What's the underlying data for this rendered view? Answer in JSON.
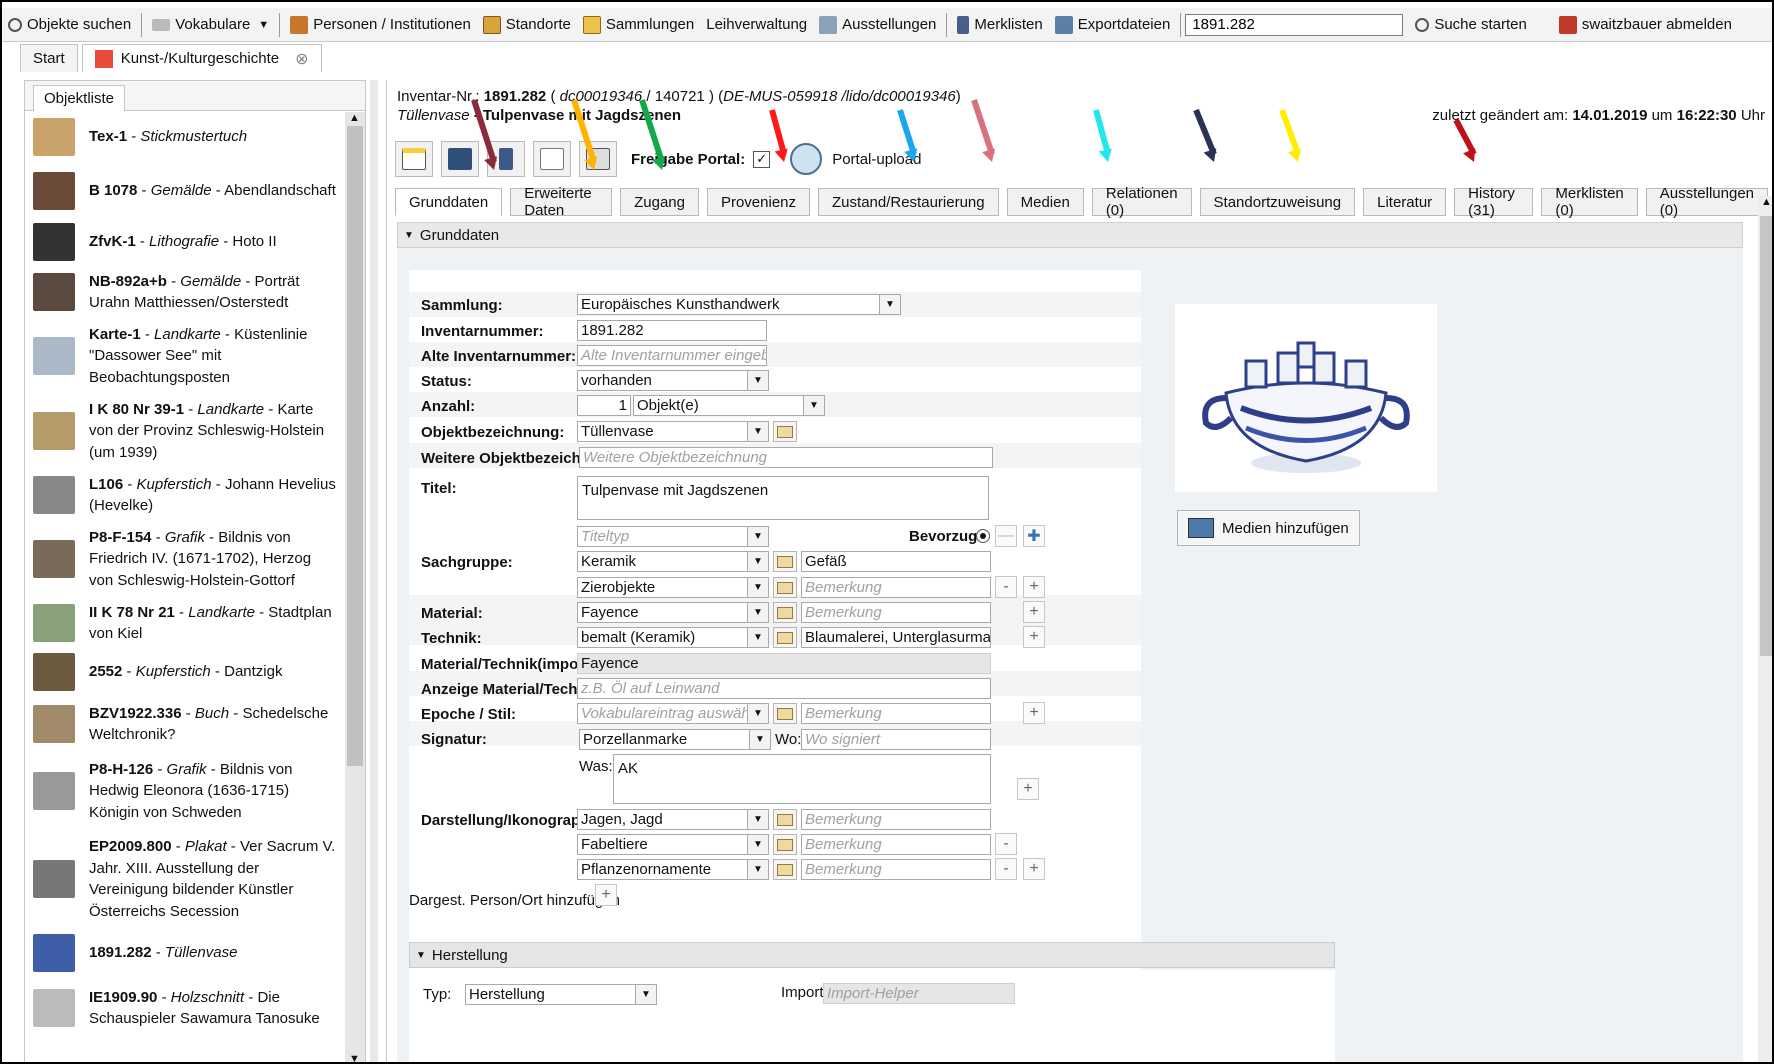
{
  "topbar": {
    "objekte_suchen": "Objekte suchen",
    "vokabulare": "Vokabulare",
    "personen": "Personen / Institutionen",
    "standorte": "Standorte",
    "sammlungen": "Sammlungen",
    "leihverwaltung": "Leihverwaltung",
    "ausstellungen": "Ausstellungen",
    "merklisten": "Merklisten",
    "exportdateien": "Exportdateien",
    "search_value": "1891.282",
    "suche_starten": "Suche starten",
    "abmelden": "swaitzbauer abmelden"
  },
  "window_tabs": {
    "start": "Start",
    "kunst": "Kunst-/Kulturgeschichte"
  },
  "left_panel": {
    "tab": "Objektliste",
    "items": [
      {
        "id": "Tex-1",
        "type": "Stickmustertuch",
        "desc": ""
      },
      {
        "id": "B 1078",
        "type": "Gemälde",
        "desc": "Abendlandschaft"
      },
      {
        "id": "ZfvK-1",
        "type": "Lithografie",
        "desc": "Hoto II"
      },
      {
        "id": "NB-892a+b",
        "type": "Gemälde",
        "desc": "Porträt Urahn Matthiessen/Osterstedt"
      },
      {
        "id": "Karte-1",
        "type": "Landkarte",
        "desc": "Küstenlinie \"Dassower See\" mit Beobachtungsposten"
      },
      {
        "id": "I K 80 Nr 39-1",
        "type": "Landkarte",
        "desc": "Karte von der Provinz Schleswig-Holstein (um 1939)"
      },
      {
        "id": "L106",
        "type": "Kupferstich",
        "desc": "Johann Hevelius (Hevelke)"
      },
      {
        "id": "P8-F-154",
        "type": "Grafik",
        "desc": "Bildnis von Friedrich IV. (1671-1702), Herzog von Schleswig-Holstein-Gottorf"
      },
      {
        "id": "II K 78 Nr 21",
        "type": "Landkarte",
        "desc": "Stadtplan von Kiel"
      },
      {
        "id": "2552",
        "type": "Kupferstich",
        "desc": "Dantzigk"
      },
      {
        "id": "BZV1922.336",
        "type": "Buch",
        "desc": "Schedelsche Weltchronik?"
      },
      {
        "id": "P8-H-126",
        "type": "Grafik",
        "desc": "Bildnis von Hedwig Eleonora (1636-1715) Königin von Schweden"
      },
      {
        "id": "EP2009.800",
        "type": "Plakat",
        "desc": "Ver Sacrum V. Jahr. XIII. Ausstellung der Vereinigung bildender Künstler Österreichs Secession"
      },
      {
        "id": "1891.282",
        "type": "Tüllenvase",
        "desc": ""
      },
      {
        "id": "IE1909.90",
        "type": "Holzschnitt",
        "desc": "Die Schauspieler Sawamura Tanosuke"
      }
    ]
  },
  "header": {
    "inv_prefix": "Inventar-Nr.:",
    "inv_nr": "1891.282",
    "inv_rest_a": " ( ",
    "inv_dc": "dc00019346",
    "inv_rest_b": " / 140721 ) (",
    "inv_lido": "DE-MUS-059918 /lido/dc00019346",
    "inv_rest_c": ")",
    "title_type": "Tüllenvase",
    "title_name": " - Tulpenvase mit Jagdszenen",
    "changed_prefix": "zuletzt geändert am: ",
    "changed_date": "14.01.2019",
    "changed_mid": " um ",
    "changed_time": "16:22:30",
    "changed_suffix": " Uhr"
  },
  "toolbar": {
    "freigabe": "Freigabe Portal:",
    "portal_upload": "Portal-upload"
  },
  "tabs": [
    "Grunddaten",
    "Erweiterte Daten",
    "Zugang",
    "Provenienz",
    "Zustand/Restaurierung",
    "Medien",
    "Relationen (0)",
    "Standortzuweisung",
    "Literatur",
    "History (31)",
    "Merklisten (0)",
    "Ausstellungen (0)"
  ],
  "section": {
    "grunddaten": "Grunddaten",
    "herstellung": "Herstellung"
  },
  "form": {
    "sammlung_label": "Sammlung:",
    "sammlung": "Europäisches Kunsthandwerk",
    "inventarnummer_label": "Inventarnummer:",
    "inventarnummer": "1891.282",
    "alte_label": "Alte Inventarnummer:",
    "alte_ph": "Alte Inventarnummer eingeben",
    "status_label": "Status:",
    "status": "vorhanden",
    "anzahl_label": "Anzahl:",
    "anzahl": "1",
    "anzahl_unit": "Objekt(e)",
    "objbez_label": "Objektbezeichnung:",
    "objbez": "Tüllenvase",
    "weitere_label": "Weitere Objektbezeichnung:",
    "weitere_ph": "Weitere Objektbezeichnung",
    "titel_label": "Titel:",
    "titel": "Tulpenvase mit Jagdszenen",
    "titeltyp_ph": "Titeltyp",
    "bevorzugt": "Bevorzugt",
    "sachgruppe_label": "Sachgruppe:",
    "sachgruppe1": "Keramik",
    "sachgruppe1_note": "Gefäß",
    "sachgruppe2": "Zierobjekte",
    "bemerkung_ph": "Bemerkung",
    "material_label": "Material:",
    "material": "Fayence",
    "technik_label": "Technik:",
    "technik": "bemalt (Keramik)",
    "technik_note": "Blaumalerei, Unterglasurmalerei",
    "mt_import_label": "Material/Technik(import):",
    "mt_import": "Fayence",
    "anzeige_label": "Anzeige Material/Technik:",
    "anzeige_ph": "z.B. Öl auf Leinwand",
    "epoche_label": "Epoche / Stil:",
    "epoche_ph": "Vokabulareintrag auswählen",
    "signatur_label": "Signatur:",
    "signatur": "Porzellanmarke",
    "wo_label": "Wo:",
    "wo_ph": "Wo signiert",
    "was_label": "Was:",
    "was": "AK",
    "darst_label": "Darstellung/Ikonographie:",
    "darst1": "Jagen, Jagd",
    "darst2": "Fabeltiere",
    "darst3": "Pflanzenornamente",
    "dargest_label": "Dargest. Person/Ort hinzufügen",
    "typ_label": "Typ:",
    "typ": "Herstellung",
    "import_label": "Import",
    "import_ph": "Import-Helper"
  },
  "media": {
    "button": "Medien hinzufügen"
  },
  "colors": {
    "arrows": [
      "#8b2a3a",
      "#ffb300",
      "#14a84a",
      "#ff1a1a",
      "#1aa7ef",
      "#d9707e",
      "#22e6f0",
      "#2b3354",
      "#ffee00",
      "#c0101a"
    ]
  }
}
